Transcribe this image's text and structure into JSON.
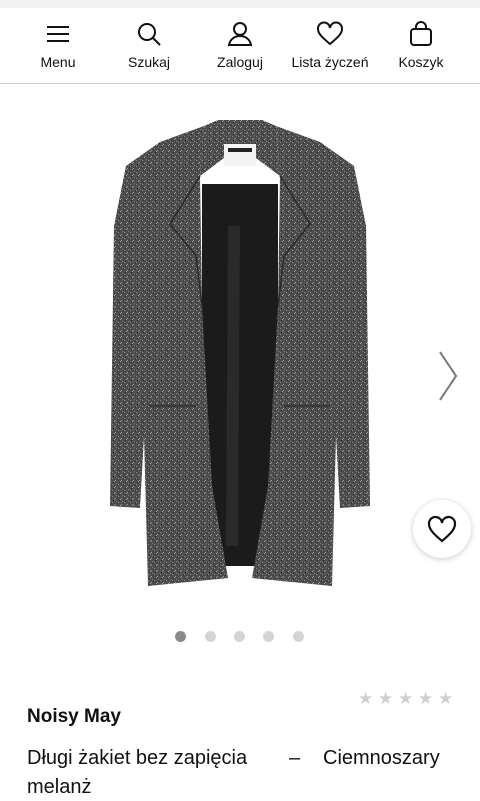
{
  "nav": {
    "items": [
      {
        "label": "Menu",
        "icon": "menu-icon"
      },
      {
        "label": "Szukaj",
        "icon": "search-icon"
      },
      {
        "label": "Zaloguj",
        "icon": "user-icon"
      },
      {
        "label": "Lista życzeń",
        "icon": "heart-icon"
      },
      {
        "label": "Koszyk",
        "icon": "bag-icon"
      }
    ]
  },
  "gallery": {
    "image_count": 5,
    "active_index": 0,
    "label_tag": "NOISY MAY"
  },
  "rating": {
    "value": 0,
    "max": 5
  },
  "product": {
    "brand": "Noisy May",
    "name_part1": "Długi żakiet bez zapięcia",
    "separator": "–",
    "color": "Ciemnoszary",
    "name_part2": "melanż"
  },
  "colors": {
    "accent": "#111111",
    "divider": "#cfcfcf",
    "dot_inactive": "#d4d4d4",
    "dot_active": "#8a8a8a",
    "star": "#cfcfcf"
  }
}
